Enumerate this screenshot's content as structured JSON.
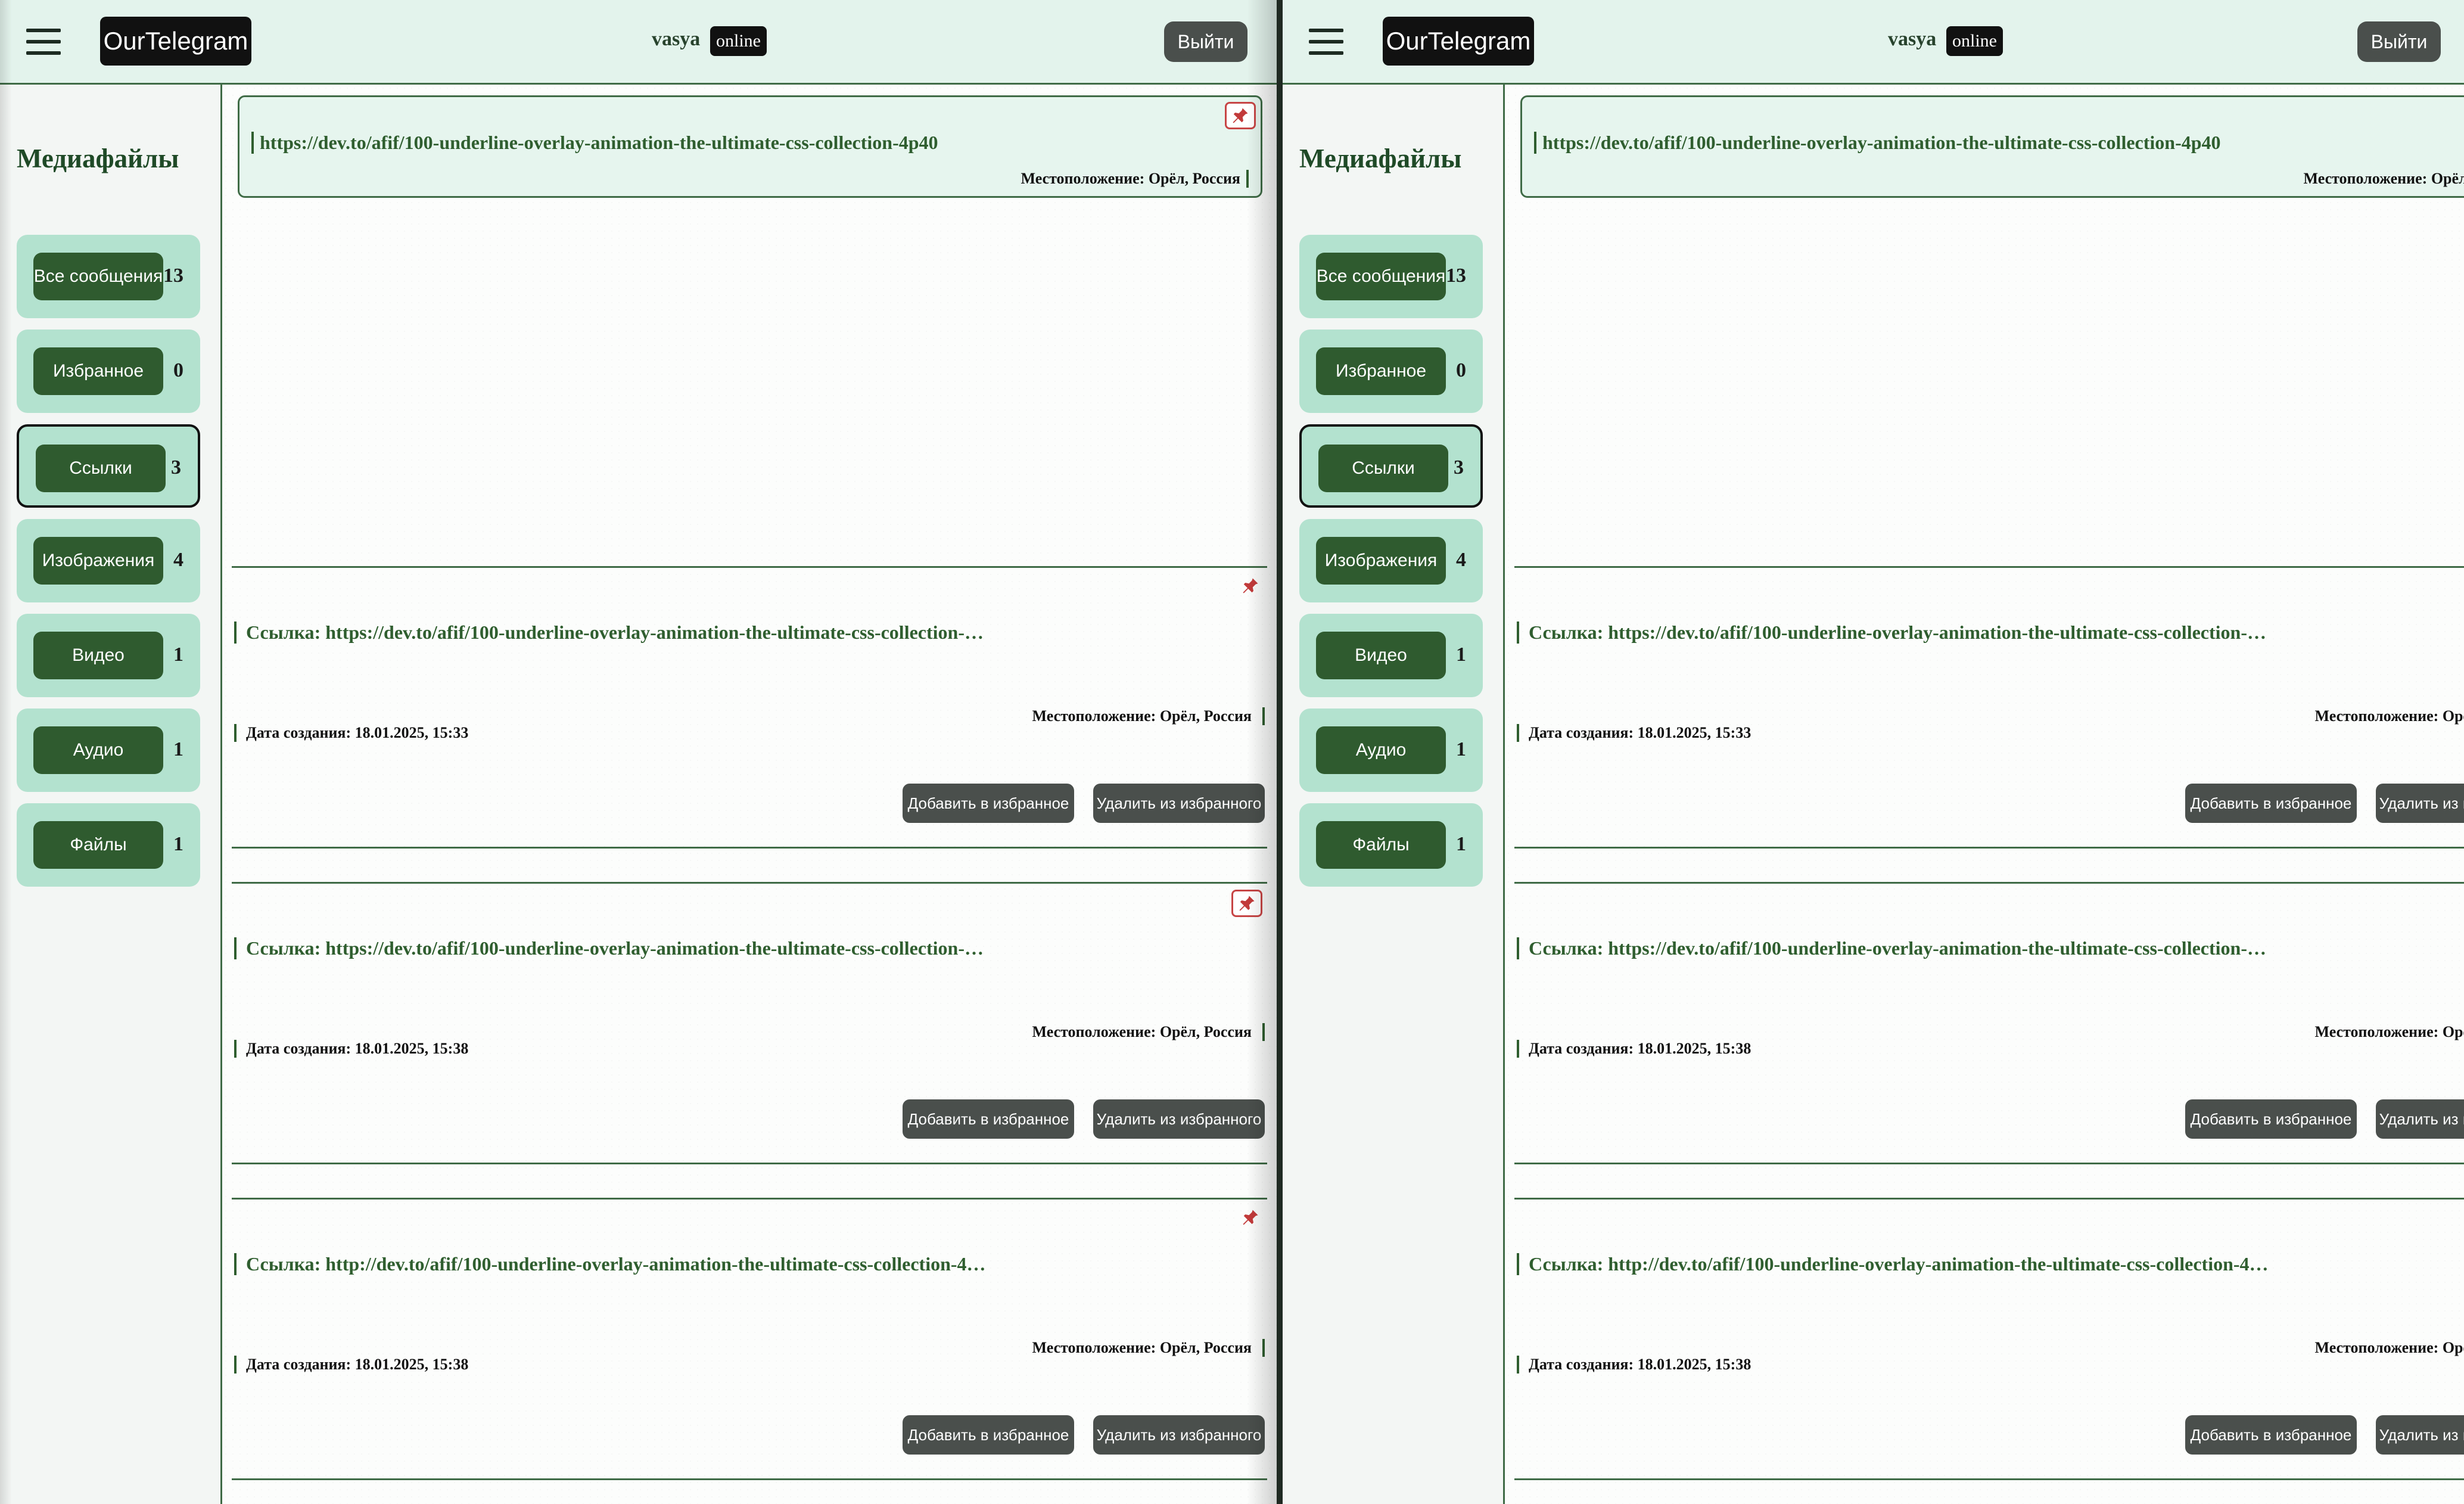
{
  "app": {
    "logo": "OurTelegram",
    "user": "vasya",
    "status": "online",
    "logout": "Выйти"
  },
  "sidebar": {
    "title": "Медиафайлы",
    "items": [
      {
        "label": "Все сообщения",
        "count": "13"
      },
      {
        "label": "Избранное",
        "count": "0"
      },
      {
        "label": "Ссылки",
        "count": "3"
      },
      {
        "label": "Изображения",
        "count": "4"
      },
      {
        "label": "Видео",
        "count": "1"
      },
      {
        "label": "Аудио",
        "count": "1"
      },
      {
        "label": "Файлы",
        "count": "1"
      }
    ],
    "active_index": 2
  },
  "pinned": {
    "link": "https://dev.to/afif/100-underline-overlay-animation-the-ultimate-css-collection-4p40",
    "location": "Местоположение: Орёл, Россия"
  },
  "messages": [
    {
      "link": "Ссылка: https://dev.to/afif/100-underline-overlay-animation-the-ultimate-css-collection-…",
      "location": "Местоположение: Орёл, Россия",
      "date": "Дата создания: 18.01.2025, 15:33",
      "pin_boxed": false
    },
    {
      "link": "Ссылка: https://dev.to/afif/100-underline-overlay-animation-the-ultimate-css-collection-…",
      "location": "Местоположение: Орёл, Россия",
      "date": "Дата создания: 18.01.2025, 15:38",
      "pin_boxed": true
    },
    {
      "link": "Ссылка: http://dev.to/afif/100-underline-overlay-animation-the-ultimate-css-collection-4…",
      "location": "Местоположение: Орёл, Россия",
      "date": "Дата создания: 18.01.2025, 15:38",
      "pin_boxed": false
    }
  ],
  "buttons": {
    "add_fav": "Добавить в избранное",
    "remove_fav": "Удалить из избранного"
  },
  "colors": {
    "accent": "#2f5b2f",
    "sidebar_item": "#b3e2cf",
    "header_bg": "#e3f3ec",
    "pin_red": "#c74545"
  },
  "icons": {
    "menu": "hamburger-menu-icon",
    "pin": "pushpin-icon"
  }
}
